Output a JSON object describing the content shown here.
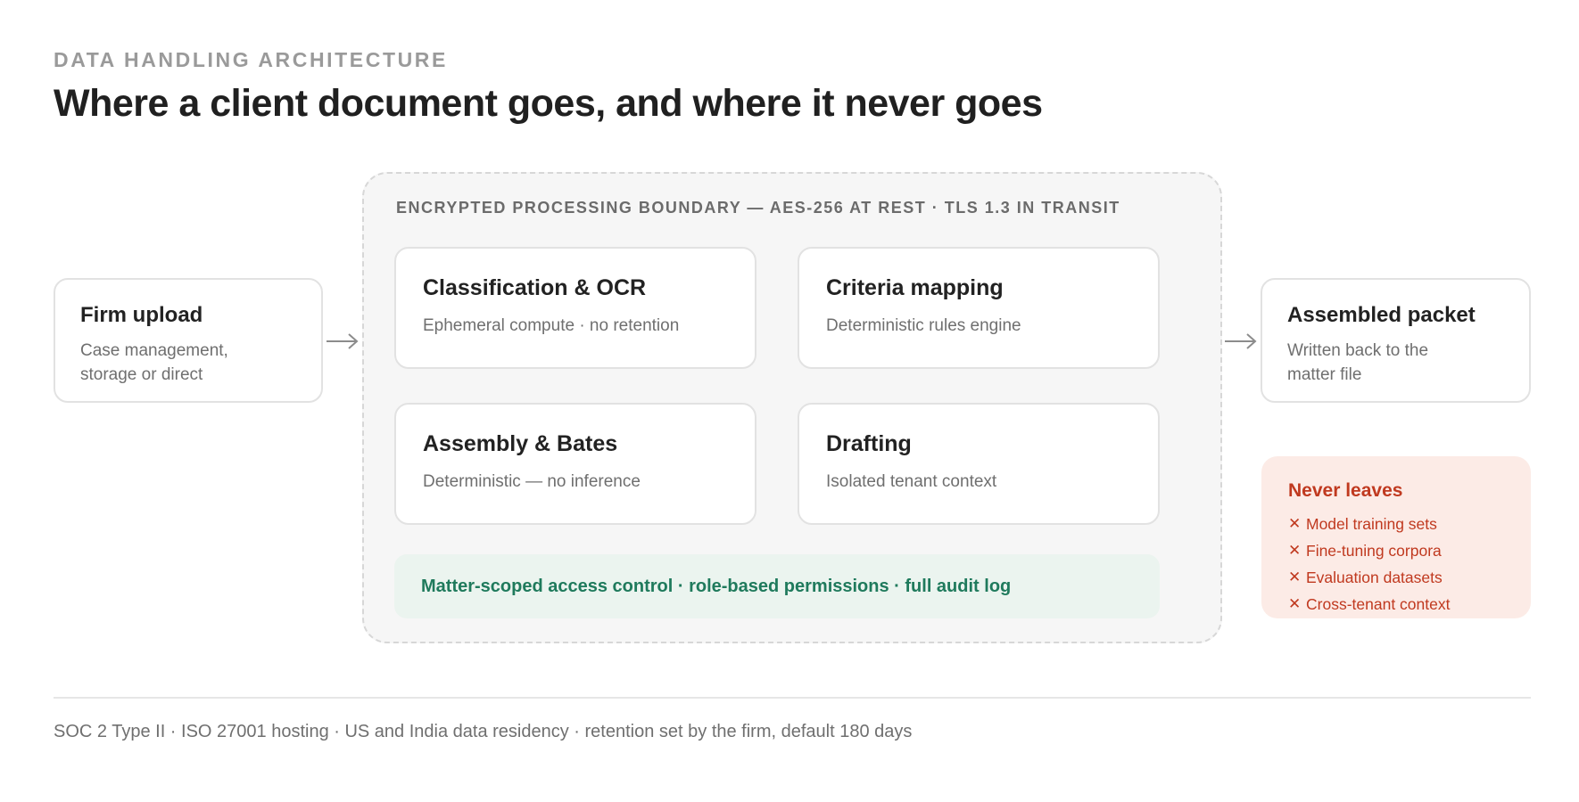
{
  "header": {
    "eyebrow": "DATA HANDLING ARCHITECTURE",
    "title": "Where a client document goes, and where it never goes"
  },
  "input_node": {
    "title": "Firm upload",
    "subtitle_lines": [
      "Case management,",
      "storage or direct"
    ]
  },
  "boundary": {
    "label": "ENCRYPTED PROCESSING BOUNDARY — AES-256 AT REST · TLS 1.3 IN TRANSIT",
    "steps": [
      {
        "title": "Classification & OCR",
        "subtitle": "Ephemeral compute · no retention"
      },
      {
        "title": "Criteria mapping",
        "subtitle": "Deterministic rules engine"
      },
      {
        "title": "Assembly & Bates",
        "subtitle": "Deterministic — no inference"
      },
      {
        "title": "Drafting",
        "subtitle": "Isolated tenant context"
      }
    ],
    "access_control": "Matter-scoped access control · role-based permissions · full audit log"
  },
  "output_node": {
    "title": "Assembled packet",
    "subtitle_lines": [
      "Written back to the",
      "matter file"
    ]
  },
  "never_leaves": {
    "title": "Never leaves",
    "marker_icon": "x-icon",
    "marker_glyph": "✕",
    "items": [
      "Model training sets",
      "Fine-tuning corpora",
      "Evaluation datasets",
      "Cross-tenant context"
    ]
  },
  "footer": {
    "note": "SOC 2 Type II · ISO 27001 hosting · US and India data residency · retention set by the firm, default 180 days"
  },
  "colors": {
    "accent_green": "#1f7a5c",
    "accent_red": "#c0391f",
    "boundary_bg": "#f6f6f6",
    "never_bg": "#fcebe6",
    "access_bg": "#ebf4ef"
  }
}
